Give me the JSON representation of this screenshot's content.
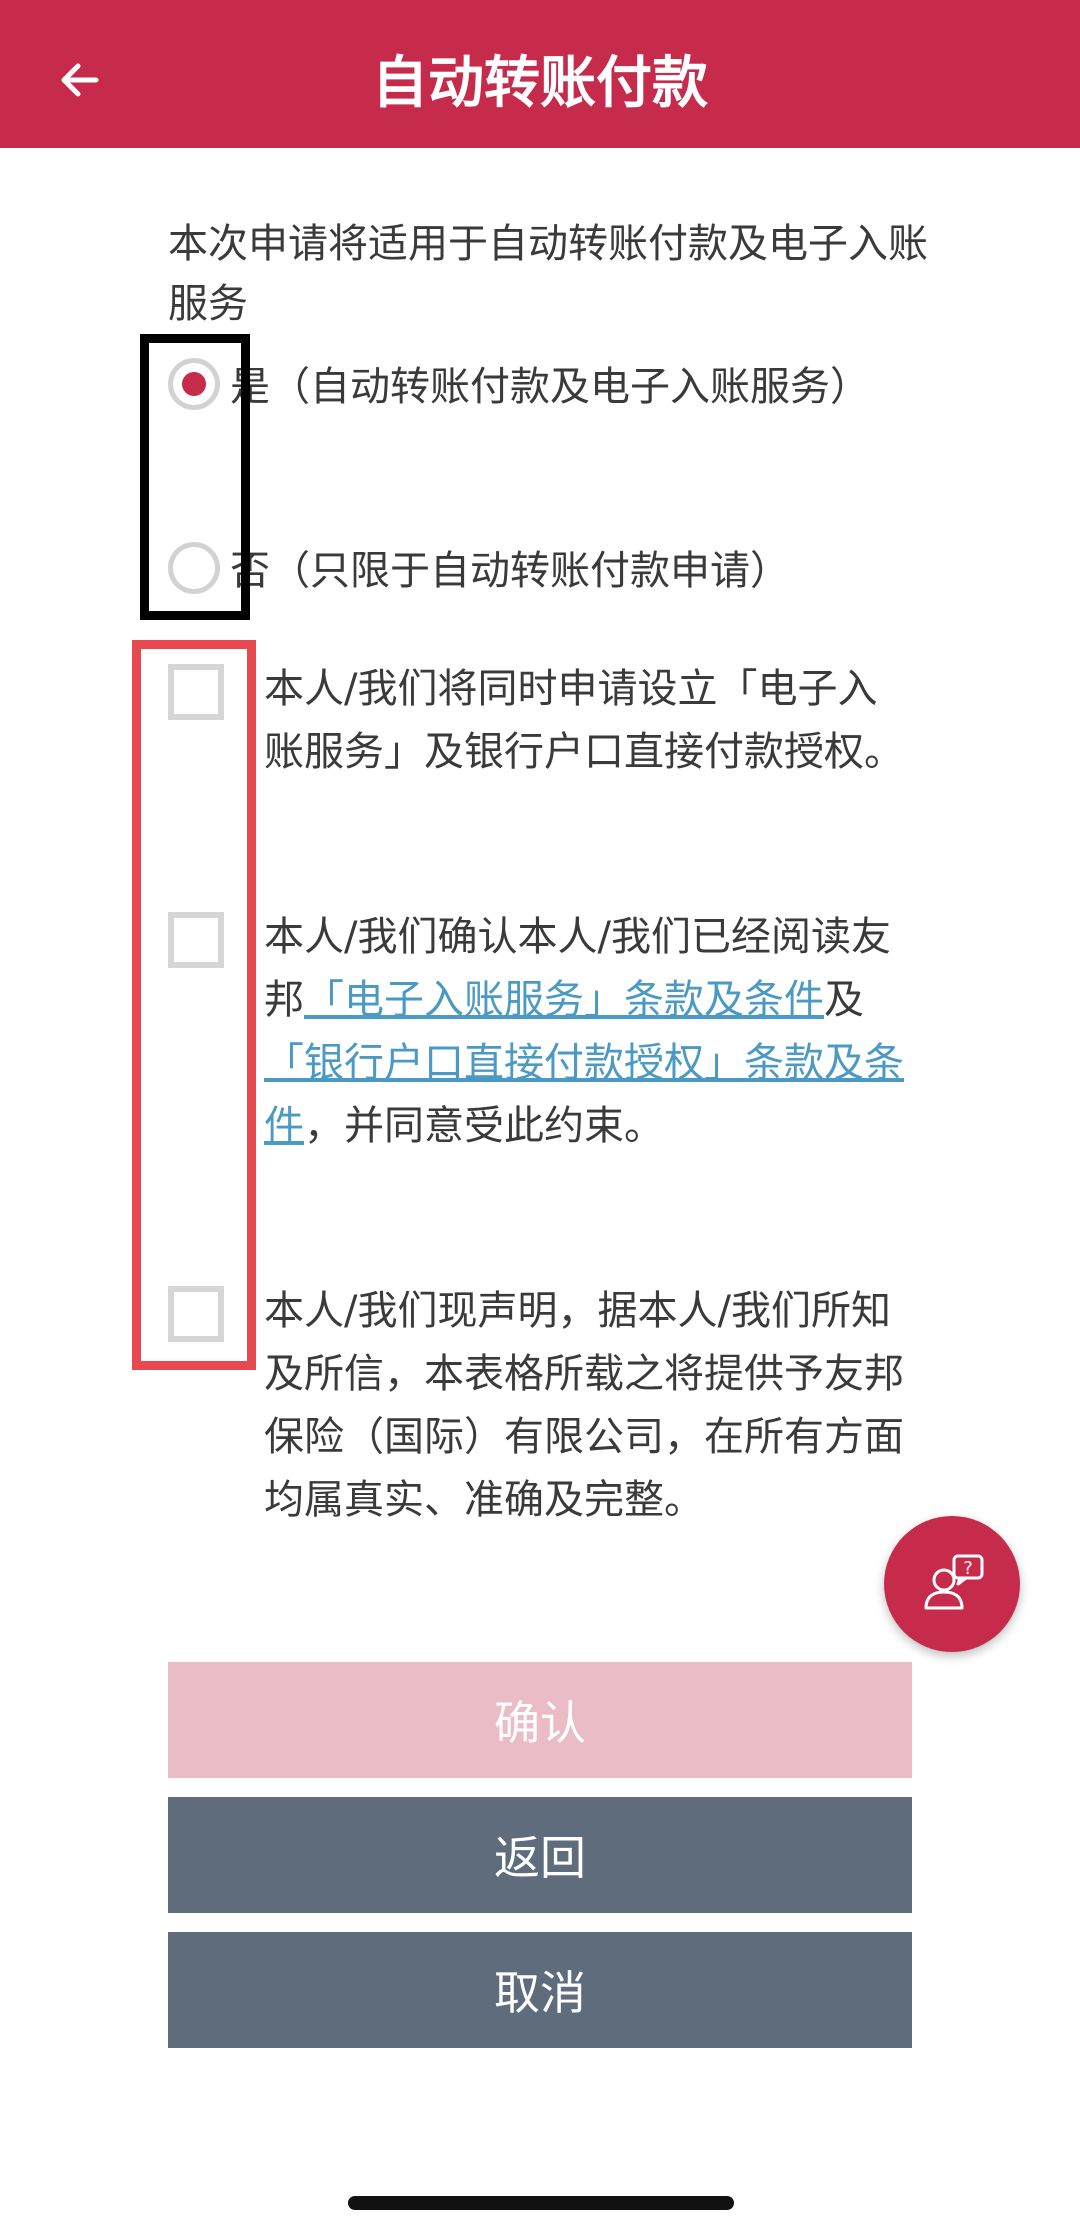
{
  "header": {
    "title": "自动转账付款",
    "back_icon": "arrow-left-icon"
  },
  "intro": "本次申请将适用于自动转账付款及电子入账服务",
  "radio_options": [
    {
      "label": "是（自动转账付款及电子入账服务）",
      "selected": true
    },
    {
      "label": "否（只限于自动转账付款申请）",
      "selected": false
    }
  ],
  "checkbox_1": {
    "text": "本人/我们将同时申请设立「电子入账服务」及银行户口直接付款授权。",
    "checked": false
  },
  "checkbox_2": {
    "text_before": "本人/我们确认本人/我们已经阅读友邦",
    "link_1": "「电子入账服务」条款及条件",
    "text_mid": "及",
    "link_2": "「银行户口直接付款授权」条款及条件",
    "text_after": "，并同意受此约束。",
    "checked": false
  },
  "checkbox_3": {
    "text": "本人/我们现声明，据本人/我们所知及所信，本表格所载之将提供予友邦保险（国际）有限公司，在所有方面均属真实、准确及完整。",
    "checked": false
  },
  "fab": {
    "icon": "support-chat-icon"
  },
  "buttons": {
    "confirm": "确认",
    "back": "返回",
    "cancel": "取消"
  },
  "colors": {
    "brand": "#c62b4b",
    "confirm_disabled": "#e9bcc6",
    "secondary_button": "#5e6c7c",
    "link": "#4b9ac4",
    "annotation_black": "#000000",
    "annotation_red": "#e64a50"
  }
}
